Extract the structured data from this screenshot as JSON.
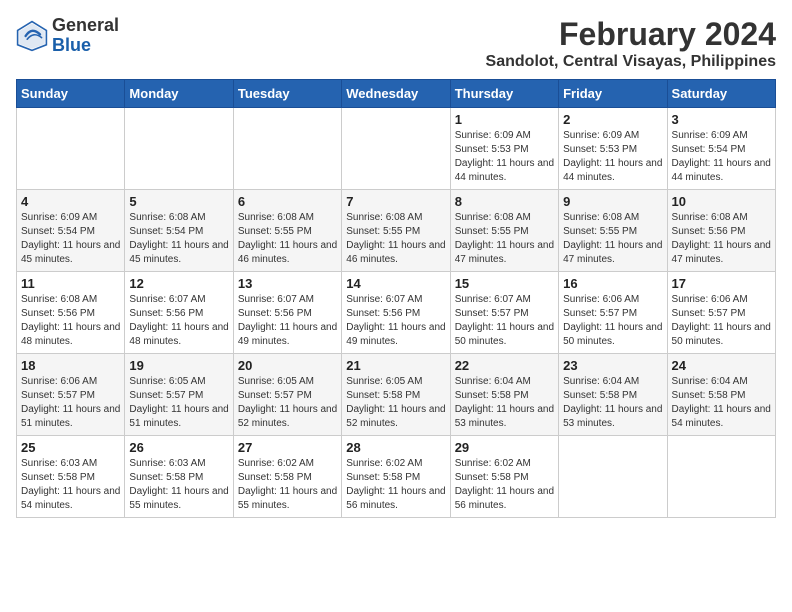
{
  "app": {
    "name": "GeneralBlue",
    "logo_text_general": "General",
    "logo_text_blue": "Blue"
  },
  "header": {
    "title": "February 2024",
    "subtitle": "Sandolot, Central Visayas, Philippines"
  },
  "calendar": {
    "days_of_week": [
      "Sunday",
      "Monday",
      "Tuesday",
      "Wednesday",
      "Thursday",
      "Friday",
      "Saturday"
    ],
    "weeks": [
      [
        {
          "day": "",
          "sunrise": "",
          "sunset": "",
          "daylight": ""
        },
        {
          "day": "",
          "sunrise": "",
          "sunset": "",
          "daylight": ""
        },
        {
          "day": "",
          "sunrise": "",
          "sunset": "",
          "daylight": ""
        },
        {
          "day": "",
          "sunrise": "",
          "sunset": "",
          "daylight": ""
        },
        {
          "day": "1",
          "sunrise": "Sunrise: 6:09 AM",
          "sunset": "Sunset: 5:53 PM",
          "daylight": "Daylight: 11 hours and 44 minutes."
        },
        {
          "day": "2",
          "sunrise": "Sunrise: 6:09 AM",
          "sunset": "Sunset: 5:53 PM",
          "daylight": "Daylight: 11 hours and 44 minutes."
        },
        {
          "day": "3",
          "sunrise": "Sunrise: 6:09 AM",
          "sunset": "Sunset: 5:54 PM",
          "daylight": "Daylight: 11 hours and 44 minutes."
        }
      ],
      [
        {
          "day": "4",
          "sunrise": "Sunrise: 6:09 AM",
          "sunset": "Sunset: 5:54 PM",
          "daylight": "Daylight: 11 hours and 45 minutes."
        },
        {
          "day": "5",
          "sunrise": "Sunrise: 6:08 AM",
          "sunset": "Sunset: 5:54 PM",
          "daylight": "Daylight: 11 hours and 45 minutes."
        },
        {
          "day": "6",
          "sunrise": "Sunrise: 6:08 AM",
          "sunset": "Sunset: 5:55 PM",
          "daylight": "Daylight: 11 hours and 46 minutes."
        },
        {
          "day": "7",
          "sunrise": "Sunrise: 6:08 AM",
          "sunset": "Sunset: 5:55 PM",
          "daylight": "Daylight: 11 hours and 46 minutes."
        },
        {
          "day": "8",
          "sunrise": "Sunrise: 6:08 AM",
          "sunset": "Sunset: 5:55 PM",
          "daylight": "Daylight: 11 hours and 47 minutes."
        },
        {
          "day": "9",
          "sunrise": "Sunrise: 6:08 AM",
          "sunset": "Sunset: 5:55 PM",
          "daylight": "Daylight: 11 hours and 47 minutes."
        },
        {
          "day": "10",
          "sunrise": "Sunrise: 6:08 AM",
          "sunset": "Sunset: 5:56 PM",
          "daylight": "Daylight: 11 hours and 47 minutes."
        }
      ],
      [
        {
          "day": "11",
          "sunrise": "Sunrise: 6:08 AM",
          "sunset": "Sunset: 5:56 PM",
          "daylight": "Daylight: 11 hours and 48 minutes."
        },
        {
          "day": "12",
          "sunrise": "Sunrise: 6:07 AM",
          "sunset": "Sunset: 5:56 PM",
          "daylight": "Daylight: 11 hours and 48 minutes."
        },
        {
          "day": "13",
          "sunrise": "Sunrise: 6:07 AM",
          "sunset": "Sunset: 5:56 PM",
          "daylight": "Daylight: 11 hours and 49 minutes."
        },
        {
          "day": "14",
          "sunrise": "Sunrise: 6:07 AM",
          "sunset": "Sunset: 5:56 PM",
          "daylight": "Daylight: 11 hours and 49 minutes."
        },
        {
          "day": "15",
          "sunrise": "Sunrise: 6:07 AM",
          "sunset": "Sunset: 5:57 PM",
          "daylight": "Daylight: 11 hours and 50 minutes."
        },
        {
          "day": "16",
          "sunrise": "Sunrise: 6:06 AM",
          "sunset": "Sunset: 5:57 PM",
          "daylight": "Daylight: 11 hours and 50 minutes."
        },
        {
          "day": "17",
          "sunrise": "Sunrise: 6:06 AM",
          "sunset": "Sunset: 5:57 PM",
          "daylight": "Daylight: 11 hours and 50 minutes."
        }
      ],
      [
        {
          "day": "18",
          "sunrise": "Sunrise: 6:06 AM",
          "sunset": "Sunset: 5:57 PM",
          "daylight": "Daylight: 11 hours and 51 minutes."
        },
        {
          "day": "19",
          "sunrise": "Sunrise: 6:05 AM",
          "sunset": "Sunset: 5:57 PM",
          "daylight": "Daylight: 11 hours and 51 minutes."
        },
        {
          "day": "20",
          "sunrise": "Sunrise: 6:05 AM",
          "sunset": "Sunset: 5:57 PM",
          "daylight": "Daylight: 11 hours and 52 minutes."
        },
        {
          "day": "21",
          "sunrise": "Sunrise: 6:05 AM",
          "sunset": "Sunset: 5:58 PM",
          "daylight": "Daylight: 11 hours and 52 minutes."
        },
        {
          "day": "22",
          "sunrise": "Sunrise: 6:04 AM",
          "sunset": "Sunset: 5:58 PM",
          "daylight": "Daylight: 11 hours and 53 minutes."
        },
        {
          "day": "23",
          "sunrise": "Sunrise: 6:04 AM",
          "sunset": "Sunset: 5:58 PM",
          "daylight": "Daylight: 11 hours and 53 minutes."
        },
        {
          "day": "24",
          "sunrise": "Sunrise: 6:04 AM",
          "sunset": "Sunset: 5:58 PM",
          "daylight": "Daylight: 11 hours and 54 minutes."
        }
      ],
      [
        {
          "day": "25",
          "sunrise": "Sunrise: 6:03 AM",
          "sunset": "Sunset: 5:58 PM",
          "daylight": "Daylight: 11 hours and 54 minutes."
        },
        {
          "day": "26",
          "sunrise": "Sunrise: 6:03 AM",
          "sunset": "Sunset: 5:58 PM",
          "daylight": "Daylight: 11 hours and 55 minutes."
        },
        {
          "day": "27",
          "sunrise": "Sunrise: 6:02 AM",
          "sunset": "Sunset: 5:58 PM",
          "daylight": "Daylight: 11 hours and 55 minutes."
        },
        {
          "day": "28",
          "sunrise": "Sunrise: 6:02 AM",
          "sunset": "Sunset: 5:58 PM",
          "daylight": "Daylight: 11 hours and 56 minutes."
        },
        {
          "day": "29",
          "sunrise": "Sunrise: 6:02 AM",
          "sunset": "Sunset: 5:58 PM",
          "daylight": "Daylight: 11 hours and 56 minutes."
        },
        {
          "day": "",
          "sunrise": "",
          "sunset": "",
          "daylight": ""
        },
        {
          "day": "",
          "sunrise": "",
          "sunset": "",
          "daylight": ""
        }
      ]
    ]
  }
}
